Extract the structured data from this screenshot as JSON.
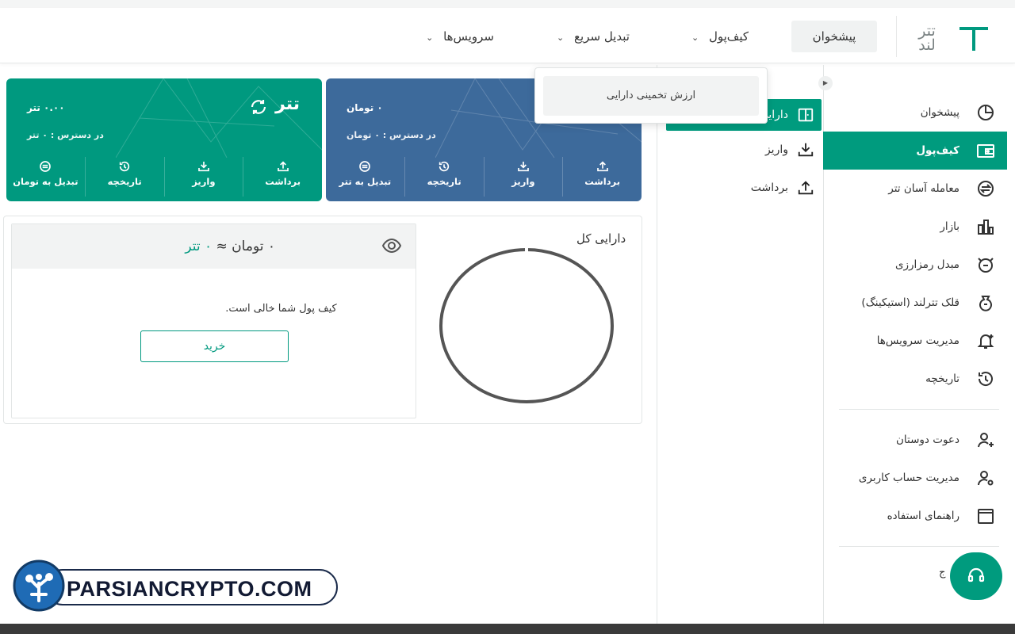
{
  "brand": {
    "logo_line1": "تتر",
    "logo_line2": "لند",
    "accent": "#009b7e",
    "blue": "#3d6a9b"
  },
  "header_nav": [
    {
      "label": "پیشخوان",
      "active": true
    },
    {
      "label": "کیف‌پول",
      "has_dropdown": true
    },
    {
      "label": "تبدیل سریع",
      "has_dropdown": true
    },
    {
      "label": "سرویس‌ها",
      "has_dropdown": true
    }
  ],
  "dropdown": {
    "item": "ارزش تخمینی دارایی"
  },
  "sidebar": {
    "items": [
      {
        "label": "پیشخوان",
        "icon": "dashboard-icon"
      },
      {
        "label": "کیف‌پول",
        "icon": "wallet-icon",
        "active": true
      },
      {
        "label": "معامله آسان تتر",
        "icon": "exchange-icon"
      },
      {
        "label": "بازار",
        "icon": "chart-bars-icon"
      },
      {
        "label": "مبدل رمزارزی",
        "icon": "converter-icon"
      },
      {
        "label": "قلک تترلند (استیکینگ)",
        "icon": "piggy-bank-icon"
      },
      {
        "label": "مدیریت سرویس‌ها",
        "icon": "bell-plus-icon"
      },
      {
        "label": "تاریخچه",
        "icon": "history-icon"
      }
    ],
    "items2": [
      {
        "label": "دعوت دوستان",
        "icon": "user-plus-icon"
      },
      {
        "label": "مدیریت حساب کاربری",
        "icon": "user-gear-icon"
      },
      {
        "label": "راهنمای استفاده",
        "icon": "guide-icon"
      }
    ]
  },
  "submenu": {
    "items": [
      {
        "label": "دارایی",
        "active": true
      },
      {
        "label": "واریز"
      },
      {
        "label": "برداشت"
      }
    ]
  },
  "cards": {
    "tether": {
      "name": "تتر",
      "balance": "۰.۰۰ تتر",
      "available": "در دسترس : ۰ تتر",
      "actions": [
        "برداشت",
        "واریز",
        "تاریخچه",
        "تبدیل به تومان"
      ]
    },
    "toman": {
      "balance": "۰ تومان",
      "available": "در دسترس : ۰ تومان",
      "actions": [
        "برداشت",
        "واریز",
        "تاریخچه",
        "تبدیل به تتر"
      ]
    }
  },
  "assets": {
    "title": "دارایی کل",
    "sum_toman": "۰ تومان",
    "approx": "≈",
    "sum_tether": "۰ تتر",
    "empty_message": "کیف پول شما خالی است.",
    "buy_label": "خرید"
  },
  "support": {
    "partial_text": "ج"
  },
  "watermark": {
    "text": "PARSIANCRYPTO.COM"
  }
}
